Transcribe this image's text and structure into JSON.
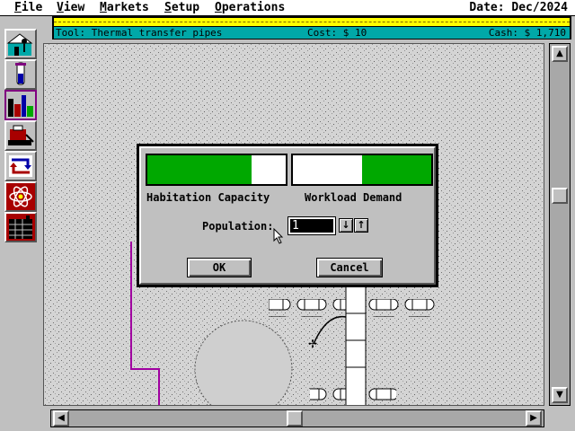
{
  "menu": {
    "items": [
      {
        "label": "File",
        "key": "F",
        "rest": "ile"
      },
      {
        "label": "View",
        "key": "V",
        "rest": "iew"
      },
      {
        "label": "Markets",
        "key": "M",
        "rest": "arkets"
      },
      {
        "label": "Setup",
        "key": "S",
        "rest": "etup"
      },
      {
        "label": "Operations",
        "key": "O",
        "rest": "perations"
      }
    ],
    "date": "Date: Dec/2024"
  },
  "status": {
    "tool": "Tool: Thermal transfer pipes",
    "cost": "Cost: $ 10",
    "cash": "Cash: $ 1,710"
  },
  "toolbar": {
    "tools": [
      {
        "icon": "colony-building-icon",
        "active": false
      },
      {
        "icon": "test-tube-icon",
        "active": false
      },
      {
        "icon": "city-buildings-icon",
        "active": true
      },
      {
        "icon": "construction-vehicle-icon",
        "active": false
      },
      {
        "icon": "recycle-arrows-icon",
        "active": false
      },
      {
        "icon": "atom-icon",
        "active": false
      },
      {
        "icon": "factory-grid-icon",
        "active": false
      }
    ]
  },
  "dialog": {
    "habitation_label": "Habitation Capacity",
    "workload_label": "Workload Demand",
    "habitation_level": 0.75,
    "workload_level": 0.5,
    "population_label": "Population:",
    "population_value": "1",
    "ok_label": "OK",
    "cancel_label": "Cancel"
  },
  "colors": {
    "gauge_fill": "#00a800",
    "info_yellow": "#ffff00",
    "info_cyan": "#00a8a8",
    "selection_border": "#800080"
  }
}
